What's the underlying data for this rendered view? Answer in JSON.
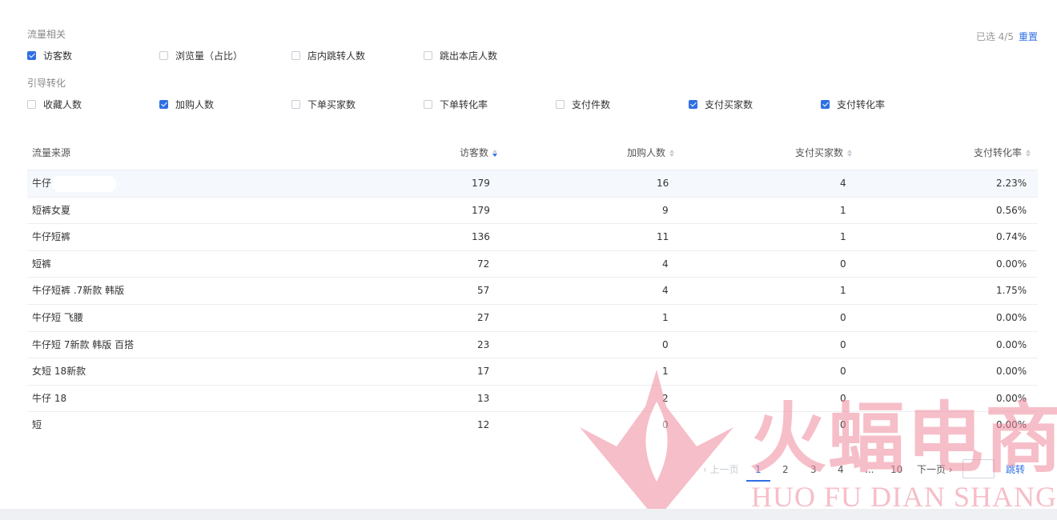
{
  "filters": {
    "group1_title": "流量相关",
    "group1": [
      {
        "label": "访客数",
        "checked": true
      },
      {
        "label": "浏览量（占比）",
        "checked": false
      },
      {
        "label": "店内跳转人数",
        "checked": false
      },
      {
        "label": "跳出本店人数",
        "checked": false
      }
    ],
    "group2_title": "引导转化",
    "group2": [
      {
        "label": "收藏人数",
        "checked": false
      },
      {
        "label": "加购人数",
        "checked": true
      },
      {
        "label": "下单买家数",
        "checked": false
      },
      {
        "label": "下单转化率",
        "checked": false
      },
      {
        "label": "支付件数",
        "checked": false
      },
      {
        "label": "支付买家数",
        "checked": true
      },
      {
        "label": "支付转化率",
        "checked": true
      }
    ],
    "selected_text": "已选 4/5",
    "reset_label": "重置"
  },
  "table": {
    "headers": [
      "流量来源",
      "访客数",
      "加购人数",
      "支付买家数",
      "支付转化率"
    ],
    "rows": [
      [
        "牛仔",
        "179",
        "16",
        "4",
        "2.23%"
      ],
      [
        "短裤女夏",
        "179",
        "9",
        "1",
        "0.56%"
      ],
      [
        "牛仔短裤",
        "136",
        "11",
        "1",
        "0.74%"
      ],
      [
        "短裤",
        "72",
        "4",
        "0",
        "0.00%"
      ],
      [
        "牛仔短裤 .7新款 韩版",
        "57",
        "4",
        "1",
        "1.75%"
      ],
      [
        "牛仔短 飞腰",
        "27",
        "1",
        "0",
        "0.00%"
      ],
      [
        "牛仔短 7新款 韩版 百搭",
        "23",
        "0",
        "0",
        "0.00%"
      ],
      [
        "女短 18新款",
        "17",
        "1",
        "0",
        "0.00%"
      ],
      [
        "牛仔 18",
        "13",
        "2",
        "0",
        "0.00%"
      ],
      [
        "短",
        "12",
        "0",
        "0",
        "0.00%"
      ]
    ]
  },
  "pager": {
    "prev": "上一页",
    "pages": [
      "1",
      "2",
      "3",
      "4",
      "...",
      "10"
    ],
    "current": "1",
    "next": "下一页",
    "jump": "跳转"
  },
  "watermark": {
    "title": "火蝠电商",
    "subtitle": "HUO FU DIAN SHANG"
  },
  "colors": {
    "accent": "#2f6fe4",
    "watermark": "#f08a9c"
  }
}
